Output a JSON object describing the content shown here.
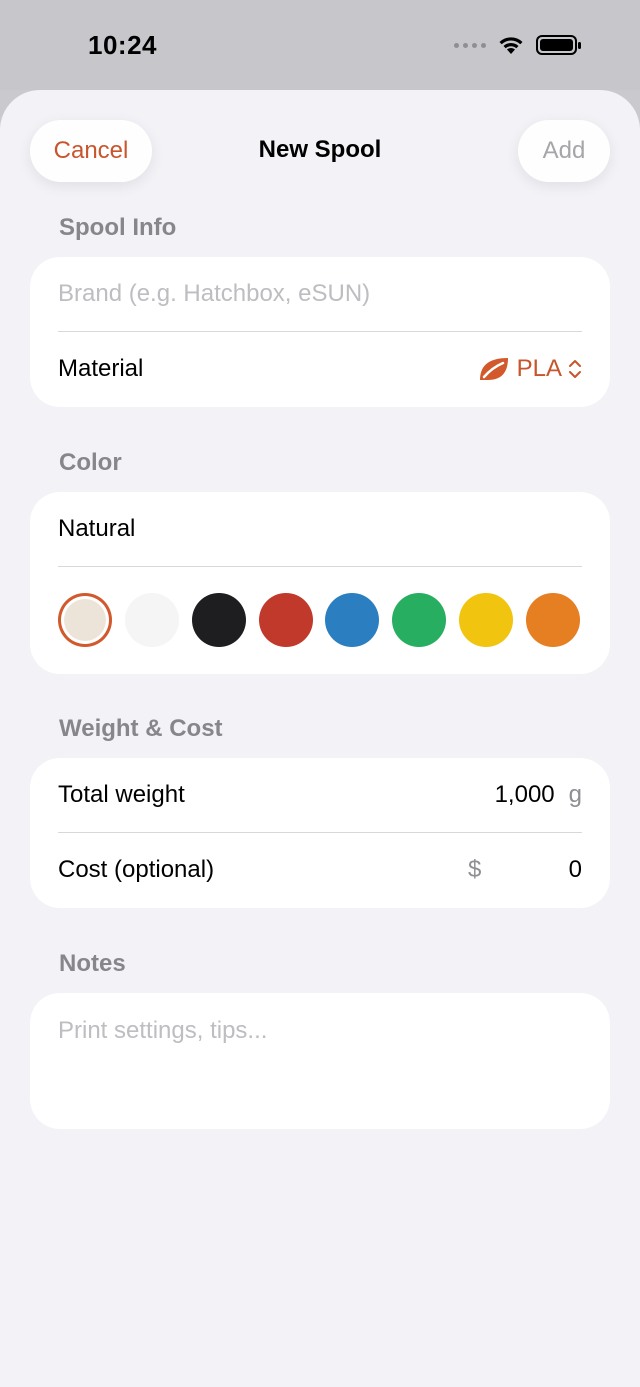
{
  "status": {
    "time": "10:24"
  },
  "nav": {
    "cancel_label": "Cancel",
    "title": "New Spool",
    "add_label": "Add"
  },
  "spool_info": {
    "header": "Spool Info",
    "brand_placeholder": "Brand (e.g. Hatchbox, eSUN)",
    "brand_value": "",
    "material_label": "Material",
    "material_value": "PLA",
    "material_icon": "leaf-icon"
  },
  "color": {
    "header": "Color",
    "selected_name": "Natural",
    "swatches": [
      {
        "name": "natural",
        "hex": "#ece4d8",
        "selected": true
      },
      {
        "name": "white",
        "hex": "#f5f5f5",
        "selected": false
      },
      {
        "name": "black",
        "hex": "#1e1e20",
        "selected": false
      },
      {
        "name": "red",
        "hex": "#c0392b",
        "selected": false
      },
      {
        "name": "blue",
        "hex": "#2b7fc0",
        "selected": false
      },
      {
        "name": "green",
        "hex": "#27ae60",
        "selected": false
      },
      {
        "name": "yellow",
        "hex": "#f1c40f",
        "selected": false
      },
      {
        "name": "orange",
        "hex": "#e67e22",
        "selected": false
      }
    ]
  },
  "weight_cost": {
    "header": "Weight & Cost",
    "total_weight_label": "Total weight",
    "total_weight_value": "1,000",
    "total_weight_unit": "g",
    "cost_label": "Cost (optional)",
    "cost_currency": "$",
    "cost_value": "0"
  },
  "notes": {
    "header": "Notes",
    "placeholder": "Print settings, tips..."
  },
  "colors": {
    "accent": "#c8552b",
    "background": "#f2f2f7"
  }
}
